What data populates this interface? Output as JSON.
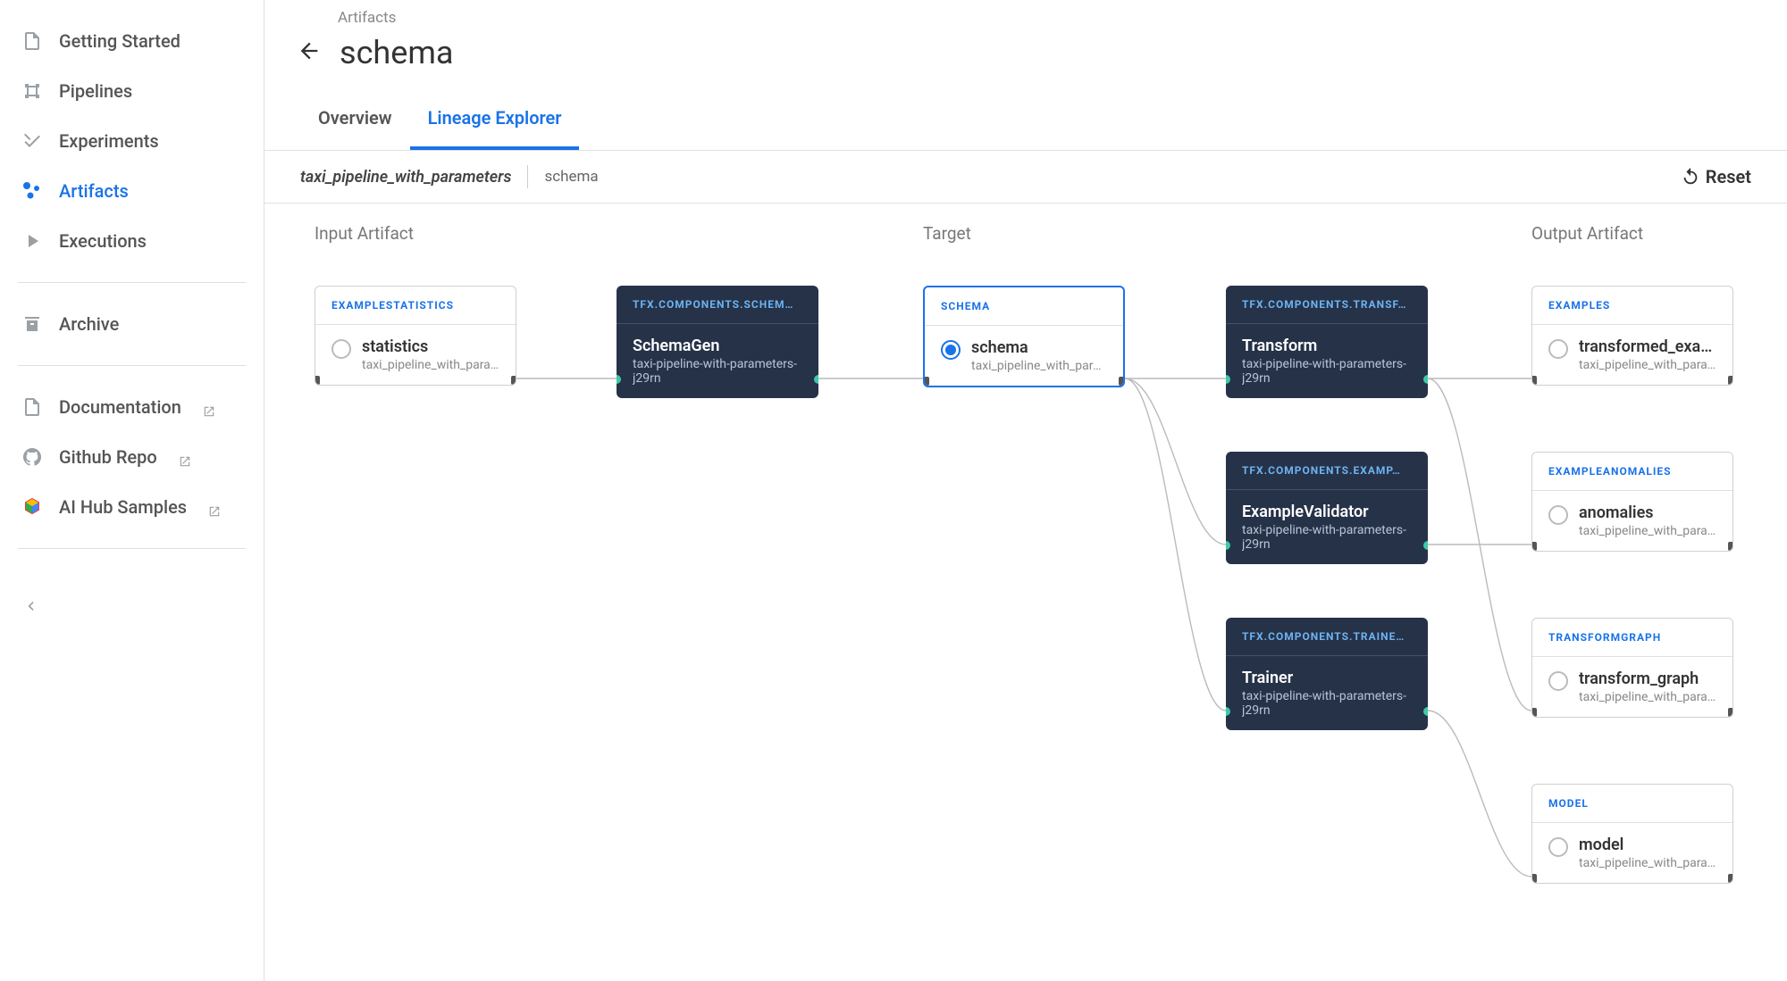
{
  "sidebar": {
    "items": [
      {
        "label": "Getting Started"
      },
      {
        "label": "Pipelines"
      },
      {
        "label": "Experiments"
      },
      {
        "label": "Artifacts"
      },
      {
        "label": "Executions"
      }
    ],
    "archive": "Archive",
    "links": [
      {
        "label": "Documentation"
      },
      {
        "label": "Github Repo"
      },
      {
        "label": "AI Hub Samples"
      }
    ]
  },
  "header": {
    "breadcrumb": "Artifacts",
    "title": "schema"
  },
  "tabs": [
    {
      "label": "Overview"
    },
    {
      "label": "Lineage Explorer"
    }
  ],
  "subbar": {
    "pipeline": "taxi_pipeline_with_parameters",
    "artifact": "schema",
    "reset": "Reset"
  },
  "columns": {
    "input": "Input Artifact",
    "target": "Target",
    "output": "Output Artifact"
  },
  "nodes": {
    "input_artifact": {
      "type": "EXAMPLESTATISTICS",
      "title": "statistics",
      "sub": "taxi_pipeline_with_parameters"
    },
    "schemagen": {
      "type": "TFX.COMPONENTS.SCHEM…",
      "title": "SchemaGen",
      "sub": "taxi-pipeline-with-parameters-j29rn"
    },
    "target": {
      "type": "SCHEMA",
      "title": "schema",
      "sub": "taxi_pipeline_with_parameters"
    },
    "transform": {
      "type": "TFX.COMPONENTS.TRANSF…",
      "title": "Transform",
      "sub": "taxi-pipeline-with-parameters-j29rn"
    },
    "validator": {
      "type": "TFX.COMPONENTS.EXAMP…",
      "title": "ExampleValidator",
      "sub": "taxi-pipeline-with-parameters-j29rn"
    },
    "trainer": {
      "type": "TFX.COMPONENTS.TRAINE…",
      "title": "Trainer",
      "sub": "taxi-pipeline-with-parameters-j29rn"
    },
    "out_examples": {
      "type": "EXAMPLES",
      "title": "transformed_examples",
      "sub": "taxi_pipeline_with_parameters"
    },
    "out_anomalies": {
      "type": "EXAMPLEANOMALIES",
      "title": "anomalies",
      "sub": "taxi_pipeline_with_parameters"
    },
    "out_tgraph": {
      "type": "TRANSFORMGRAPH",
      "title": "transform_graph",
      "sub": "taxi_pipeline_with_parameters"
    },
    "out_model": {
      "type": "MODEL",
      "title": "model",
      "sub": "taxi_pipeline_with_parameters"
    }
  }
}
